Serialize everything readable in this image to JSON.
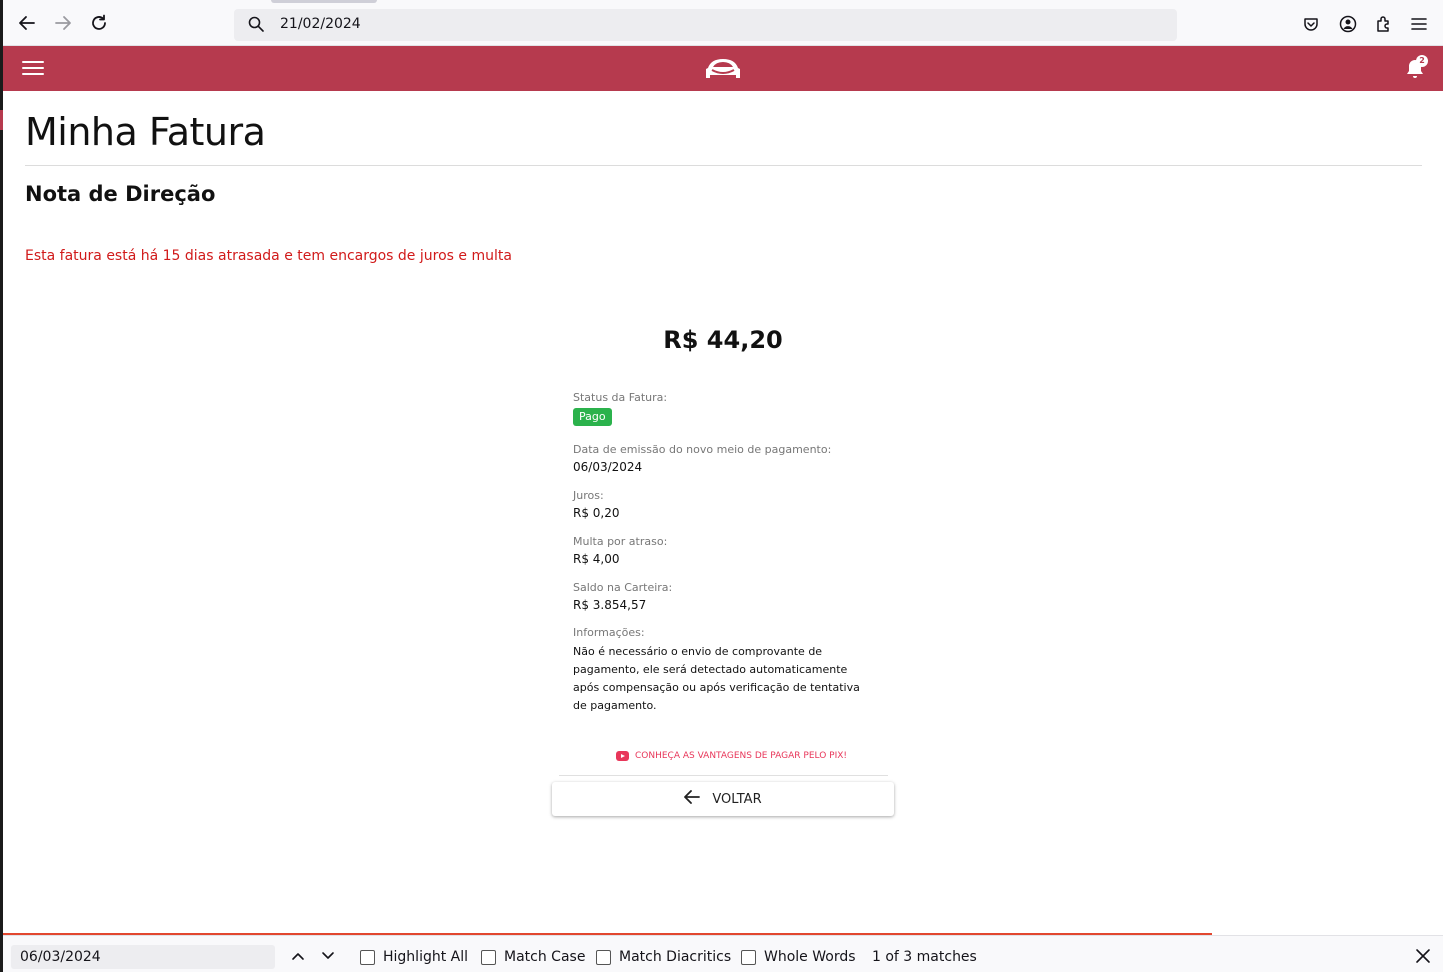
{
  "browser": {
    "url": "21/02/2024"
  },
  "app": {
    "title": "Minha Fatura",
    "notification_count": "2"
  },
  "invoice": {
    "name": "Nota de Direção",
    "warning": "Esta fatura está há 15 dias atrasada e tem encargos de juros e multa",
    "amount": "R$ 44,20",
    "fields": {
      "status_label": "Status da Fatura:",
      "status_value": "Pago",
      "emission_label": "Data de emissão do novo meio de pagamento:",
      "emission_value": "06/03/2024",
      "interest_label": "Juros:",
      "interest_value": "R$ 0,20",
      "fine_label": "Multa por atraso:",
      "fine_value": "R$ 4,00",
      "wallet_label": "Saldo na Carteira:",
      "wallet_value": "R$ 3.854,57",
      "info_label": "Informações:",
      "info_value": "Não é necessário o envio de comprovante de pagamento, ele será detectado automaticamente após compensação ou após verificação de tentativa de pagamento."
    },
    "pix_link": "CONHEÇA AS VANTAGENS DE PAGAR PELO PIX!",
    "back_label": "VOLTAR"
  },
  "findbar": {
    "query": "06/03/2024",
    "highlight_all": "Highlight All",
    "match_case": "Match Case",
    "match_diacritics": "Match Diacritics",
    "whole_words": "Whole Words",
    "result": "1 of 3 matches"
  },
  "colors": {
    "header": "#b63a4e",
    "warning": "#d11a1a",
    "paid_badge": "#2bb24c",
    "pix_link": "#e8375a"
  }
}
